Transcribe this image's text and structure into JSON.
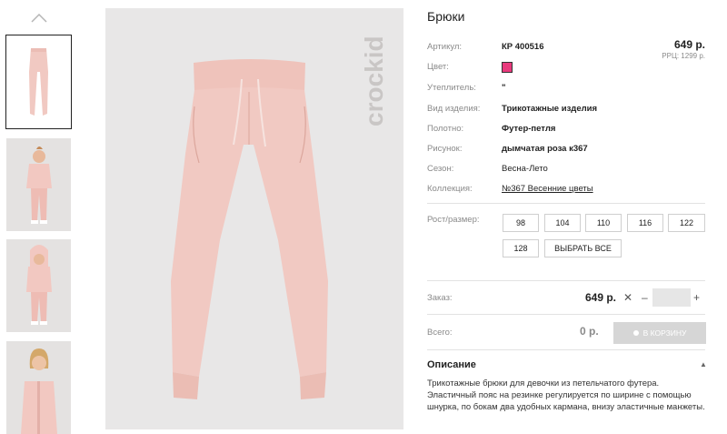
{
  "product": {
    "title": "Брюки",
    "price": "649 р.",
    "rrp": "РРЦ: 1299 р.",
    "brand_mark": "crockid",
    "color_hex": "#e93a7d",
    "pants_color": "#f1c9c2"
  },
  "specs": [
    {
      "label": "Артикул:",
      "value": "КР 400516"
    },
    {
      "label": "Цвет:",
      "value": ""
    },
    {
      "label": "Утеплитель:",
      "value": "\""
    },
    {
      "label": "Вид изделия:",
      "value": "Трикотажные изделия"
    },
    {
      "label": "Полотно:",
      "value": "Футер-петля"
    },
    {
      "label": "Рисунок:",
      "value": "дымчатая роза к367"
    },
    {
      "label": "Сезон:",
      "value": "Весна-Лето"
    },
    {
      "label": "Коллекция:",
      "value": "№367 Весенние цветы"
    }
  ],
  "sizes": {
    "label": "Рост/размер:",
    "options": [
      "98",
      "104",
      "110",
      "116",
      "122",
      "128"
    ],
    "select_all": "ВЫБРАТЬ ВСЕ"
  },
  "order": {
    "label": "Заказ:",
    "price": "649 р.",
    "times": "✕",
    "minus": "–",
    "plus": "+",
    "quantity": ""
  },
  "total": {
    "label": "Всего:",
    "value": "0 р.",
    "cart_button": "В КОРЗИНУ"
  },
  "description": {
    "heading": "Описание",
    "lines": [
      "Трикотажные брюки для девочки из петельчатого футера.",
      "Эластичный пояс на резинке регулируется по ширине с помощью",
      "шнурка, по бокам два удобных кармана, внизу эластичные манжеты."
    ]
  },
  "icons": {
    "thumb_up": "chevron-up-icon",
    "collapse": "chevron-up-small-icon",
    "cart": "cart-icon"
  }
}
